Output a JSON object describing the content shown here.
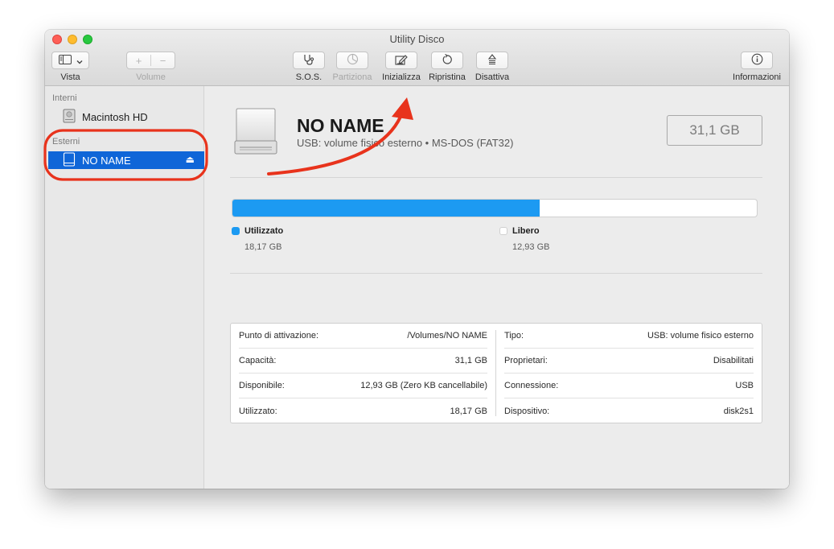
{
  "window": {
    "title": "Utility Disco"
  },
  "toolbar": {
    "vista_label": "Vista",
    "volume_label": "Volume",
    "volume_plus": "+",
    "volume_minus": "−",
    "sos_label": "S.O.S.",
    "partiziona_label": "Partiziona",
    "inizializza_label": "Inizializza",
    "ripristina_label": "Ripristina",
    "disattiva_label": "Disattiva",
    "info_label": "Informazioni"
  },
  "sidebar": {
    "interni_header": "Interni",
    "esterni_header": "Esterni",
    "internal_item": "Macintosh HD",
    "external_item": "NO NAME"
  },
  "volume": {
    "name": "NO NAME",
    "description": "USB: volume fisico esterno • MS-DOS (FAT32)",
    "capacity": "31,1 GB"
  },
  "usage": {
    "used_fraction": 0.5866,
    "used_label": "Utilizzato",
    "used_value": "18,17 GB",
    "free_label": "Libero",
    "free_value": "12,93 GB",
    "used_color": "#1c9af2",
    "free_color": "#ffffff"
  },
  "info": {
    "left": [
      {
        "label": "Punto di attivazione:",
        "value": "/Volumes/NO NAME"
      },
      {
        "label": "Capacità:",
        "value": "31,1 GB"
      },
      {
        "label": "Disponibile:",
        "value": "12,93 GB (Zero KB cancellabile)"
      },
      {
        "label": "Utilizzato:",
        "value": "18,17 GB"
      }
    ],
    "right": [
      {
        "label": "Tipo:",
        "value": "USB: volume fisico esterno"
      },
      {
        "label": "Proprietari:",
        "value": "Disabilitati"
      },
      {
        "label": "Connessione:",
        "value": "USB"
      },
      {
        "label": "Dispositivo:",
        "value": "disk2s1"
      }
    ]
  },
  "colors": {
    "selection": "#0f66d8",
    "annotation": "#e8331c"
  },
  "icons": [
    "sidebar-toggle-icon",
    "stethoscope-icon",
    "pie-chart-icon",
    "erase-icon",
    "restore-icon",
    "unmount-icon",
    "info-icon",
    "disk-icon",
    "eject-icon"
  ]
}
